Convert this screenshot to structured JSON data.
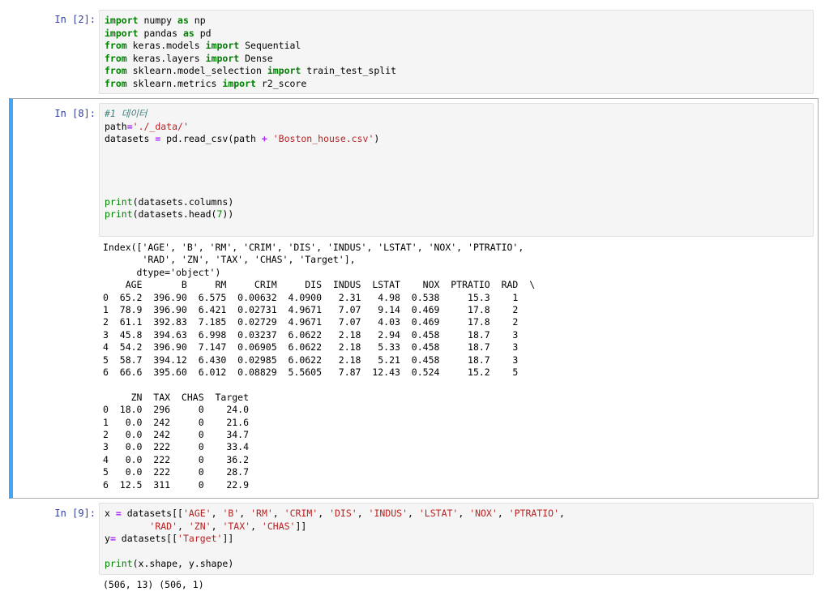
{
  "cell1": {
    "prompt": "In [2]:",
    "lines": [
      [
        [
          "kw",
          "import"
        ],
        [
          "t",
          " numpy "
        ],
        [
          "kw",
          "as"
        ],
        [
          "t",
          " np"
        ]
      ],
      [
        [
          "kw",
          "import"
        ],
        [
          "t",
          " pandas "
        ],
        [
          "kw",
          "as"
        ],
        [
          "t",
          " pd"
        ]
      ],
      [
        [
          "kw",
          "from"
        ],
        [
          "t",
          " keras.models "
        ],
        [
          "kw",
          "import"
        ],
        [
          "t",
          " Sequential"
        ]
      ],
      [
        [
          "kw",
          "from"
        ],
        [
          "t",
          " keras.layers "
        ],
        [
          "kw",
          "import"
        ],
        [
          "t",
          " Dense"
        ]
      ],
      [
        [
          "kw",
          "from"
        ],
        [
          "t",
          " sklearn.model_selection "
        ],
        [
          "kw",
          "import"
        ],
        [
          "t",
          " train_test_split"
        ]
      ],
      [
        [
          "kw",
          "from"
        ],
        [
          "t",
          " sklearn.metrics "
        ],
        [
          "kw",
          "import"
        ],
        [
          "t",
          " r2_score"
        ]
      ]
    ]
  },
  "cell2": {
    "prompt": "In [8]:",
    "lines": [
      [
        [
          "cmt",
          "#1 데이터"
        ]
      ],
      [
        [
          "t",
          "path"
        ],
        [
          "op",
          "="
        ],
        [
          "str",
          "'./_data/'"
        ]
      ],
      [
        [
          "t",
          "datasets "
        ],
        [
          "op",
          "="
        ],
        [
          "t",
          " pd.read_csv(path "
        ],
        [
          "op",
          "+"
        ],
        [
          "t",
          " "
        ],
        [
          "str",
          "'Boston_house.csv'"
        ],
        [
          "t",
          ")"
        ]
      ],
      [
        [
          "t",
          ""
        ]
      ],
      [
        [
          "t",
          ""
        ]
      ],
      [
        [
          "t",
          ""
        ]
      ],
      [
        [
          "t",
          ""
        ]
      ],
      [
        [
          "builtin",
          "print"
        ],
        [
          "t",
          "(datasets.columns)"
        ]
      ],
      [
        [
          "builtin",
          "print"
        ],
        [
          "t",
          "(datasets.head("
        ],
        [
          "num",
          "7"
        ],
        [
          "t",
          "))"
        ]
      ]
    ],
    "output": [
      "Index(['AGE', 'B', 'RM', 'CRIM', 'DIS', 'INDUS', 'LSTAT', 'NOX', 'PTRATIO',",
      "       'RAD', 'ZN', 'TAX', 'CHAS', 'Target'],",
      "      dtype='object')",
      "    AGE       B     RM     CRIM     DIS  INDUS  LSTAT    NOX  PTRATIO  RAD  \\",
      "0  65.2  396.90  6.575  0.00632  4.0900   2.31   4.98  0.538     15.3    1",
      "1  78.9  396.90  6.421  0.02731  4.9671   7.07   9.14  0.469     17.8    2",
      "2  61.1  392.83  7.185  0.02729  4.9671   7.07   4.03  0.469     17.8    2",
      "3  45.8  394.63  6.998  0.03237  6.0622   2.18   2.94  0.458     18.7    3",
      "4  54.2  396.90  7.147  0.06905  6.0622   2.18   5.33  0.458     18.7    3",
      "5  58.7  394.12  6.430  0.02985  6.0622   2.18   5.21  0.458     18.7    3",
      "6  66.6  395.60  6.012  0.08829  5.5605   7.87  12.43  0.524     15.2    5",
      "",
      "     ZN  TAX  CHAS  Target",
      "0  18.0  296     0    24.0",
      "1   0.0  242     0    21.6",
      "2   0.0  242     0    34.7",
      "3   0.0  222     0    33.4",
      "4   0.0  222     0    36.2",
      "5   0.0  222     0    28.7",
      "6  12.5  311     0    22.9"
    ]
  },
  "cell3": {
    "prompt": "In [9]:",
    "lines": [
      [
        [
          "t",
          "x "
        ],
        [
          "op",
          "="
        ],
        [
          "t",
          " datasets[["
        ],
        [
          "str",
          "'AGE'"
        ],
        [
          "t",
          ", "
        ],
        [
          "str",
          "'B'"
        ],
        [
          "t",
          ", "
        ],
        [
          "str",
          "'RM'"
        ],
        [
          "t",
          ", "
        ],
        [
          "str",
          "'CRIM'"
        ],
        [
          "t",
          ", "
        ],
        [
          "str",
          "'DIS'"
        ],
        [
          "t",
          ", "
        ],
        [
          "str",
          "'INDUS'"
        ],
        [
          "t",
          ", "
        ],
        [
          "str",
          "'LSTAT'"
        ],
        [
          "t",
          ", "
        ],
        [
          "str",
          "'NOX'"
        ],
        [
          "t",
          ", "
        ],
        [
          "str",
          "'PTRATIO'"
        ],
        [
          "t",
          ","
        ]
      ],
      [
        [
          "t",
          "        "
        ],
        [
          "str",
          "'RAD'"
        ],
        [
          "t",
          ", "
        ],
        [
          "str",
          "'ZN'"
        ],
        [
          "t",
          ", "
        ],
        [
          "str",
          "'TAX'"
        ],
        [
          "t",
          ", "
        ],
        [
          "str",
          "'CHAS'"
        ],
        [
          "t",
          "]]"
        ]
      ],
      [
        [
          "t",
          "y"
        ],
        [
          "op",
          "="
        ],
        [
          "t",
          " datasets[["
        ],
        [
          "str",
          "'Target'"
        ],
        [
          "t",
          "]]"
        ]
      ],
      [
        [
          "t",
          ""
        ]
      ],
      [
        [
          "builtin",
          "print"
        ],
        [
          "t",
          "(x.shape, y.shape)"
        ]
      ]
    ],
    "output": [
      "(506, 13) (506, 1)"
    ]
  }
}
